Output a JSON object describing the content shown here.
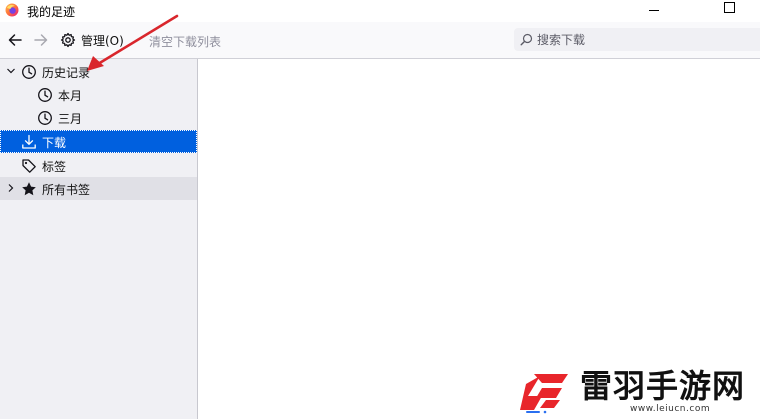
{
  "window": {
    "title": "我的足迹"
  },
  "toolbar": {
    "organize_label": "管理(O)",
    "clear_label": "清空下载列表",
    "search_placeholder": "搜索下载"
  },
  "sidebar": {
    "items": [
      {
        "label": "历史记录",
        "icon": "clock-icon",
        "twisty": "expanded"
      },
      {
        "label": "本月",
        "icon": "clock-icon"
      },
      {
        "label": "三月",
        "icon": "clock-icon"
      },
      {
        "label": "下载",
        "icon": "download-icon",
        "selected": true
      },
      {
        "label": "标签",
        "icon": "tag-icon"
      },
      {
        "label": "所有书签",
        "icon": "star-icon",
        "twisty": "collapsed"
      }
    ]
  },
  "watermark": {
    "name": "雷羽手游网",
    "url": "www.leiucn.com"
  },
  "colors": {
    "selection": "#0060df",
    "sidebar_bg": "#f0f0f4",
    "annotation": "#d9262c"
  }
}
